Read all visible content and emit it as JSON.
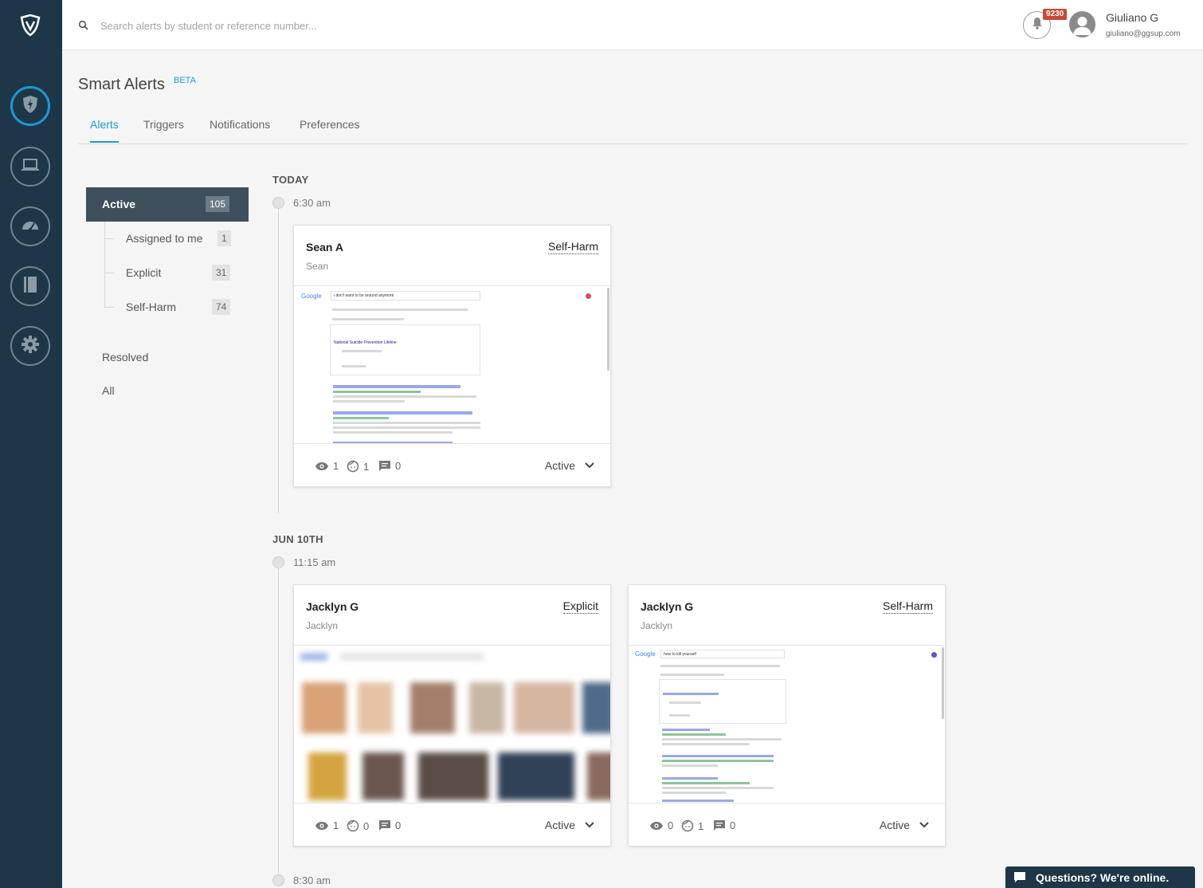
{
  "search": {
    "placeholder": "Search alerts by student or reference number..."
  },
  "header": {
    "notification_count": "9230",
    "user_name": "Giuliano G",
    "user_email": "giuliano@ggsup.com"
  },
  "page": {
    "title": "Smart Alerts",
    "beta": "BETA"
  },
  "tabs": [
    {
      "label": "Alerts"
    },
    {
      "label": "Triggers"
    },
    {
      "label": "Notifications"
    },
    {
      "label": "Preferences"
    }
  ],
  "filters": {
    "active": {
      "label": "Active",
      "count": "105"
    },
    "sub": [
      {
        "label": "Assigned to me",
        "count": "1"
      },
      {
        "label": "Explicit",
        "count": "31"
      },
      {
        "label": "Self-Harm",
        "count": "74"
      }
    ],
    "resolved": "Resolved",
    "all": "All"
  },
  "timeline": {
    "day1": "TODAY",
    "time1": "6:30 am",
    "day2": "JUN 10TH",
    "time2": "11:15 am",
    "time3": "8:30 am"
  },
  "cards": [
    {
      "name": "Sean A",
      "user": "Sean",
      "category": "Self-Harm",
      "views": "1",
      "people": "1",
      "comments": "0",
      "status": "Active"
    },
    {
      "name": "Jacklyn G",
      "user": "Jacklyn",
      "category": "Explicit",
      "views": "1",
      "people": "0",
      "comments": "0",
      "status": "Active"
    },
    {
      "name": "Jacklyn G",
      "user": "Jacklyn",
      "category": "Self-Harm",
      "views": "0",
      "people": "1",
      "comments": "0",
      "status": "Active"
    }
  ],
  "screens": {
    "logo": "Google",
    "query1": "i don't want to be around anymore",
    "query2": "how to kill yourself",
    "lifeline": "National Suicide Prevention Lifeline"
  },
  "chat": {
    "label": "Questions? We're online."
  },
  "colors": {
    "sidebar": "#1d3748",
    "accent": "#1e9bd8",
    "badge": "#c64a35"
  }
}
